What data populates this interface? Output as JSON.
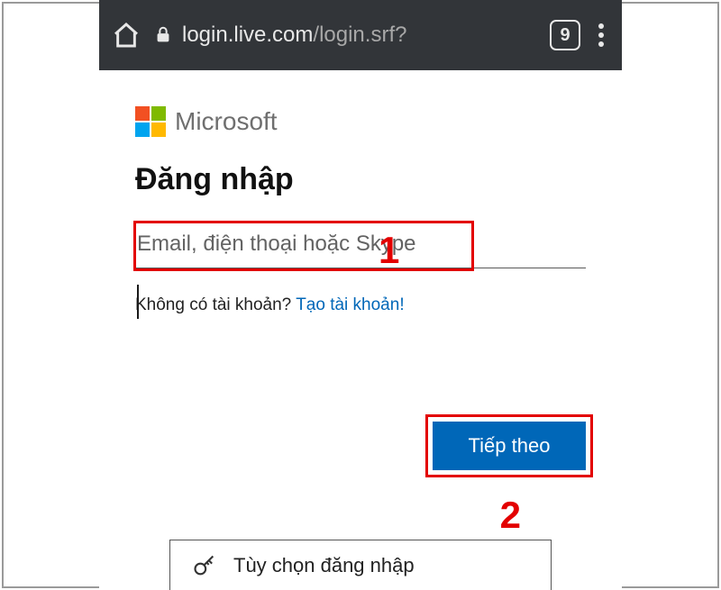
{
  "browser": {
    "url_host": "login.live.com",
    "url_path": "/login.srf?",
    "tab_count": "9"
  },
  "brand": {
    "wordmark": "Microsoft"
  },
  "signin": {
    "heading": "Đăng nhập",
    "email_placeholder": "Email, điện thoại hoặc Skype",
    "no_account_text": "Không có tài khoản? ",
    "create_account_link": "Tạo tài khoản!",
    "next_button": "Tiếp theo",
    "options_label": "Tùy chọn đăng nhập"
  },
  "annotations": {
    "one": "1",
    "two": "2"
  }
}
